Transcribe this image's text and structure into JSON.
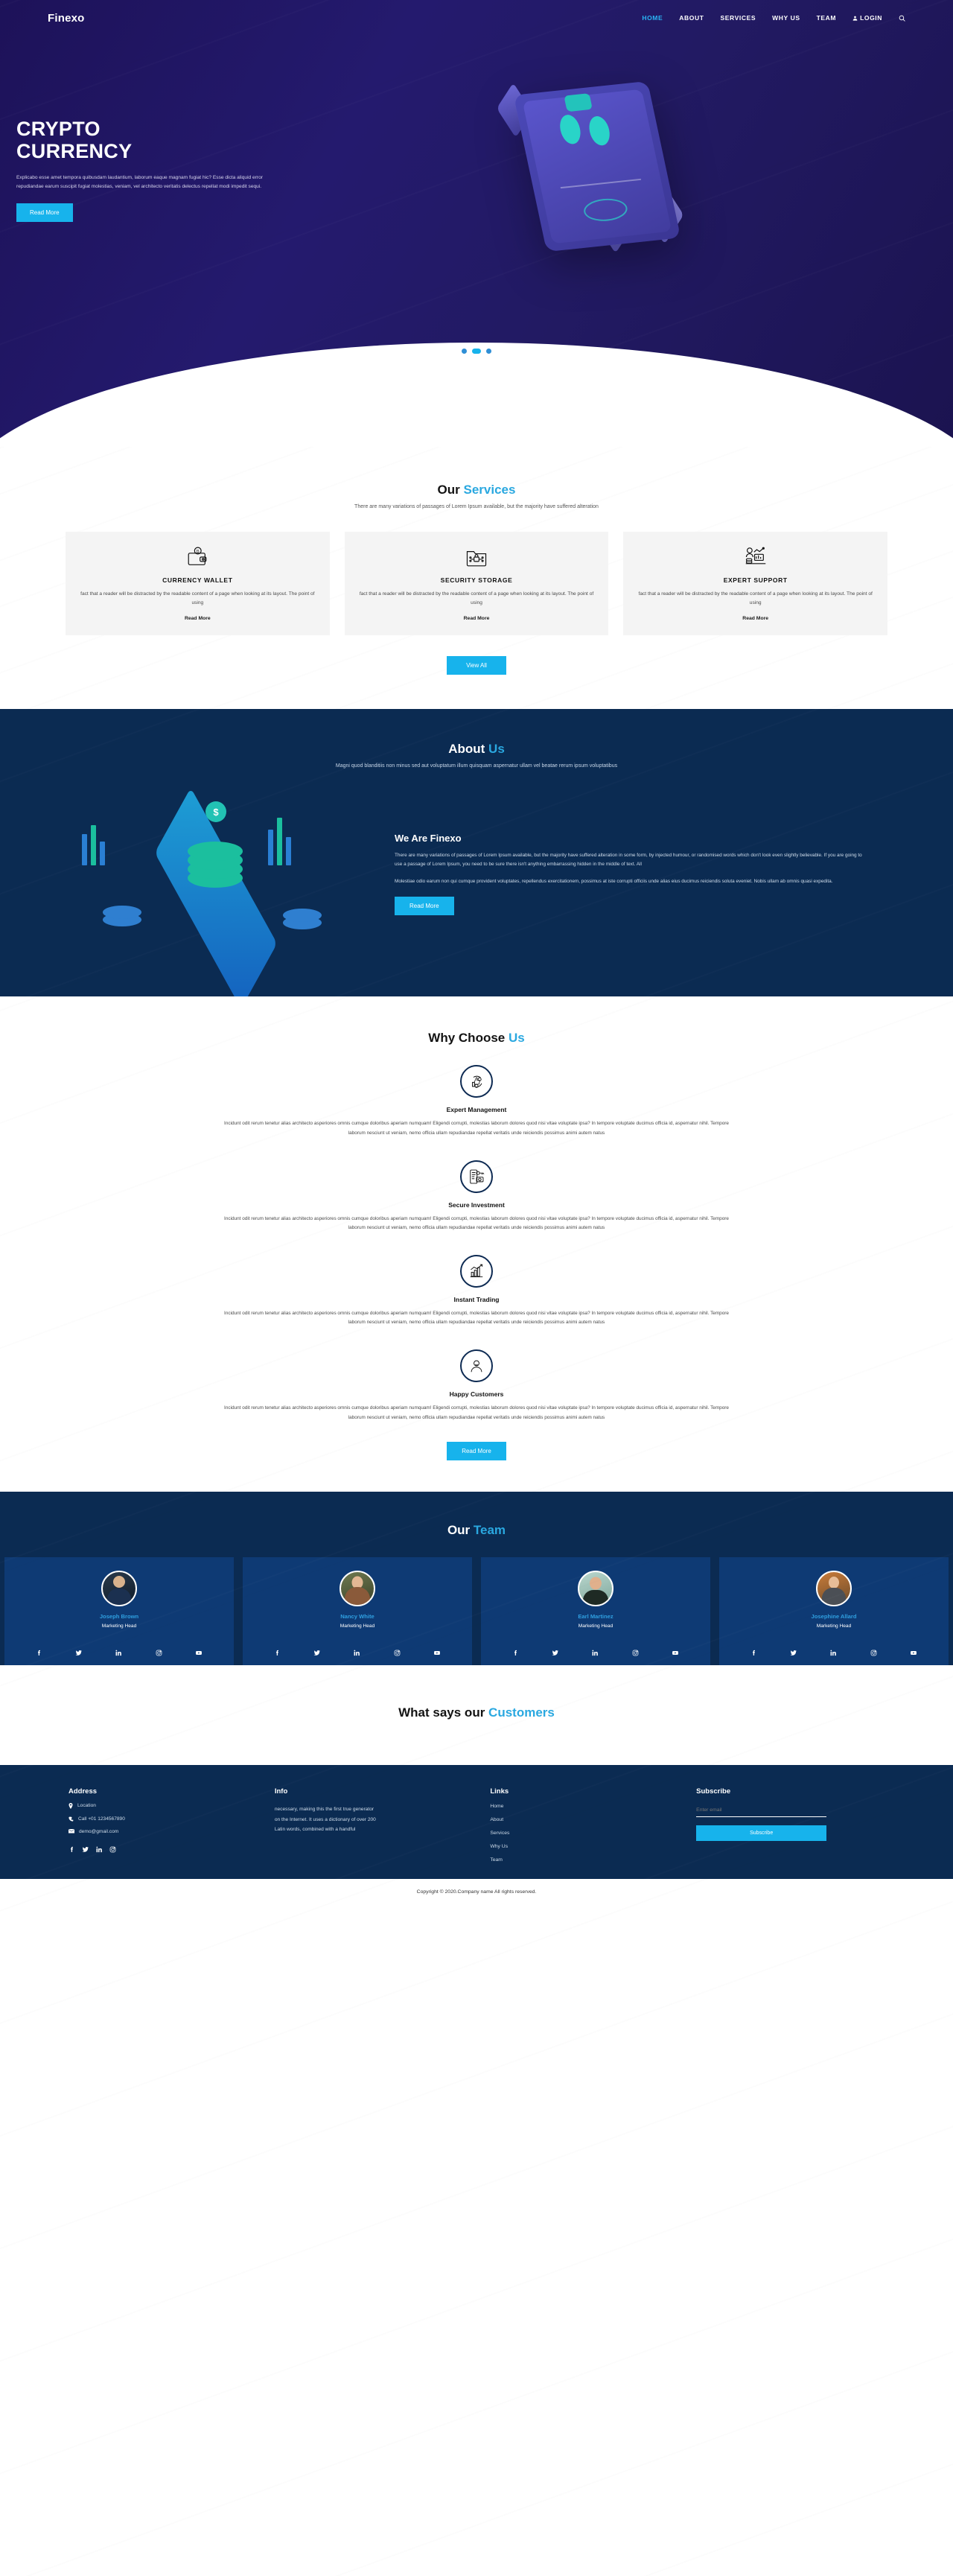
{
  "brand": "Finexo",
  "nav": {
    "items": [
      {
        "label": "HOME",
        "active": true
      },
      {
        "label": "ABOUT",
        "active": false
      },
      {
        "label": "SERVICES",
        "active": false
      },
      {
        "label": "WHY US",
        "active": false
      },
      {
        "label": "TEAM",
        "active": false
      }
    ],
    "login": "LOGIN",
    "search_icon": "search-icon",
    "user_icon": "user-icon"
  },
  "hero": {
    "title_line1": "CRYPTO",
    "title_line2": "CURRENCY",
    "paragraph": "Explicabo esse amet tempora quibusdam laudantium, laborum eaque magnam fugiat hic? Esse dicta aliquid error repudiandae earum suscipit fugiat molestias, veniam, vel architecto veritatis delectus repellat modi impedit sequi.",
    "cta": "Read More",
    "slides": 3,
    "active_slide": 2
  },
  "services": {
    "title_lead": "Our ",
    "title_accent": "Services",
    "subtitle": "There are many variations of passages of Lorem Ipsum available, but the majority have suffered alteration",
    "cards": [
      {
        "icon": "wallet-bitcoin-icon",
        "title": "CURRENCY WALLET",
        "text": "fact that a reader will be distracted by the readable content of a page when looking at its layout. The point of using",
        "link": "Read More"
      },
      {
        "icon": "folder-lock-icon",
        "title": "SECURITY STORAGE",
        "text": "fact that a reader will be distracted by the readable content of a page when looking at its layout. The point of using",
        "link": "Read More"
      },
      {
        "icon": "expert-chart-icon",
        "title": "EXPERT SUPPORT",
        "text": "fact that a reader will be distracted by the readable content of a page when looking at its layout. The point of using",
        "link": "Read More"
      }
    ],
    "view_all": "View All"
  },
  "about": {
    "title_lead": "About ",
    "title_accent": "Us",
    "subtitle": "Magni quod blanditiis non minus sed aut voluptatum illum quisquam aspernatur ullam vel beatae rerum ipsum voluptatibus",
    "heading": "We Are Finexo",
    "paragraph1": "There are many variations of passages of Lorem Ipsum available, but the majority have suffered alteration in some form, by injected humour, or randomised words which don't look even slightly believable. If you are going to use a passage of Lorem Ipsum, you need to be sure there isn't anything embarrassing hidden in the middle of text. All",
    "paragraph2": "Molestiae odio earum non qui cumque provident voluptates, repellendus exercitationem, possimus at iste corrupti officiis unde alias eius ducimus reiciendis soluta eveniet. Nobis ullam ab omnis quasi expedita.",
    "cta": "Read More"
  },
  "why": {
    "title_lead": "Why Choose ",
    "title_accent": "Us",
    "body": "Incidunt odit rerum tenetur alias architecto asperiores omnis cumque doloribus aperiam numquam! Eligendi corrupti, molestias laborum dolores quod nisi vitae voluptate ipsa? In tempore voluptate ducimus officia id, aspernatur nihil. Tempore laborum nesciunt ut veniam, nemo officia ullam repudiandae repellat veritatis unde reiciendis possimus animi autem natus",
    "items": [
      {
        "icon": "thumbs-up-cycle-icon",
        "title": "Expert Management"
      },
      {
        "icon": "phone-key-money-icon",
        "title": "Secure Investment"
      },
      {
        "icon": "chart-growth-icon",
        "title": "Instant Trading"
      },
      {
        "icon": "happy-person-icon",
        "title": "Happy Customers"
      }
    ],
    "cta": "Read More"
  },
  "team": {
    "title_lead": "Our ",
    "title_accent": "Team",
    "members": [
      {
        "name": "Joseph Brown",
        "role": "Marketing Head",
        "avatar": "man-suit-photo"
      },
      {
        "name": "Nancy White",
        "role": "Marketing Head",
        "avatar": "woman-long-hair-photo"
      },
      {
        "name": "Earl Martinez",
        "role": "Marketing Head",
        "avatar": "man-glasses-photo"
      },
      {
        "name": "Josephine Allard",
        "role": "Marketing Head",
        "avatar": "woman-office-photo"
      }
    ],
    "socials": [
      "facebook-icon",
      "twitter-icon",
      "linkedin-icon",
      "instagram-icon",
      "youtube-icon"
    ]
  },
  "customers": {
    "title_lead": "What says our ",
    "title_accent": "Customers"
  },
  "footer": {
    "address": {
      "heading": "Address",
      "location": "Location",
      "phone": "Call +01 1234567890",
      "email": "demo@gmail.com",
      "socials": [
        "facebook-icon",
        "twitter-icon",
        "linkedin-icon",
        "instagram-icon"
      ]
    },
    "info": {
      "heading": "Info",
      "text": "necessary, making this the first true generator on the Internet. It uses a dictionary of over 200 Latin words, combined with a handful"
    },
    "links": {
      "heading": "Links",
      "items": [
        "Home",
        "About",
        "Services",
        "Why Us",
        "Team"
      ]
    },
    "subscribe": {
      "heading": "Subscribe",
      "placeholder": "Enter email",
      "value": "",
      "button": "Subscribe"
    },
    "copyright": "Copyright © 2020.Company name All rights reserved."
  },
  "colors": {
    "accent": "#17b3ec",
    "hero_bg": "#221a63",
    "dark_blue": "#0b2b52",
    "team_card": "#0e3a74"
  }
}
